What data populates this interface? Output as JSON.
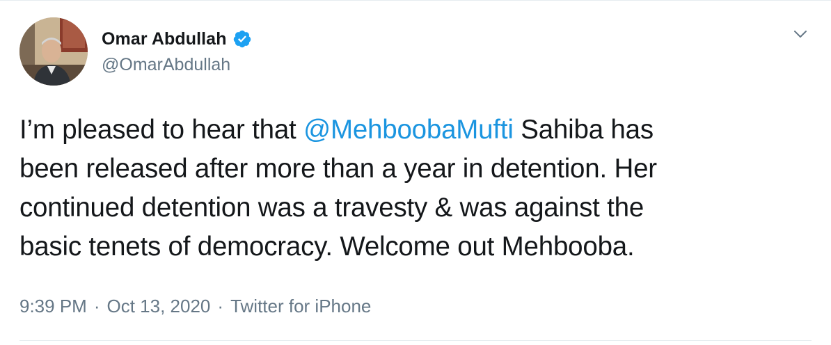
{
  "tweet": {
    "author": {
      "display_name": "Omar Abdullah",
      "handle": "@OmarAbdullah",
      "verified": true
    },
    "text": {
      "line1_before": "I’m pleased to hear that ",
      "mention": "@MehboobaMufti",
      "line1_after": " Sahiba has",
      "line2": "been released after more than a year in detention. Her",
      "line3": "continued detention was a travesty & was against the",
      "line4": "basic tenets of democracy. Welcome out Mehbooba."
    },
    "meta": {
      "time": "9:39 PM",
      "date": "Oct 13, 2020",
      "separator": "·",
      "source": "Twitter for iPhone"
    },
    "icons": {
      "verified": "verified-badge-icon",
      "caret": "chevron-down-icon"
    },
    "colors": {
      "link": "#1b95e0",
      "verified": "#1da1f2",
      "secondary_text": "#657786",
      "primary_text": "#14171a"
    }
  }
}
